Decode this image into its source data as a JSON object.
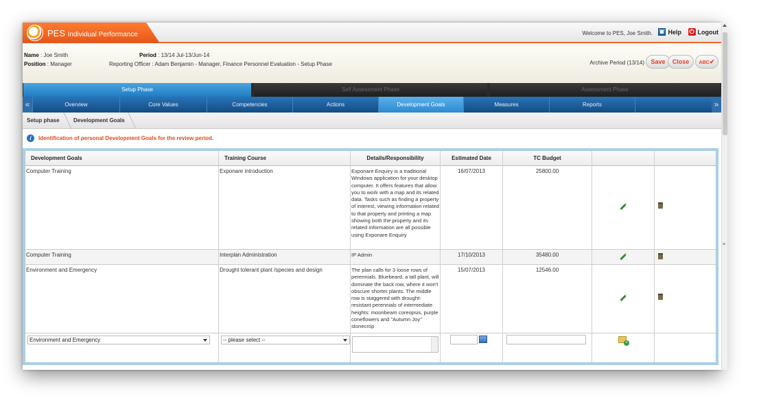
{
  "app": {
    "brand_prefix": "PES",
    "brand_suffix": "Individual Performance",
    "welcome": "Welcome to PES, Joe Smith.",
    "help": "Help",
    "logout": "Logout"
  },
  "info": {
    "name_label": "Name",
    "name_value": ": Joe Smith",
    "position_label": "Position",
    "position_value": ": Manager",
    "period_label": "Period",
    "period_value": ": 13/14 Jul-13/Jun-14",
    "reporting": "Reporting Officer : Adam Benjamin - Manager, Finance Personnel Evaluation - Setup Phase",
    "archive": "Archive Period (13/14)",
    "save": "Save",
    "close": "Close",
    "spell": "ABC"
  },
  "phases": [
    "Setup Phase",
    "Self Assessment Phase",
    "Assessment Phase"
  ],
  "tabs": [
    "Overview",
    "Core Values",
    "Competencies",
    "Actions",
    "Development Goals",
    "Measures",
    "Reports"
  ],
  "breadcrumb": [
    "Setup phase",
    "Development Goals"
  ],
  "notice": "Identification of personal Development Goals for the review period.",
  "table": {
    "headers": [
      "Development Goals",
      "Training Course",
      "Details/Responsibility",
      "Estimated Date",
      "TC Budget"
    ],
    "rows": [
      {
        "goal": "Computer Training",
        "course": "Exponare introduction",
        "details": "Exponare Enquiry is a traditional Windows application for your desktop computer. It offers features that allow you to work with a map and its related data. Tasks such as finding a property of interest, viewing information related to that property and printing a map showing both the property and its related information are all possible using Exponare Enquiry",
        "date": "16/07/2013",
        "budget": "25800.00"
      },
      {
        "goal": "Computer Training",
        "course": "Interplan Administration",
        "details": "IP Admin",
        "date": "17/10/2013",
        "budget": "35480.00"
      },
      {
        "goal": "Environment and Emergency",
        "course": "Drought tolerant plant /species and design",
        "details": "The plan calls for 3 loose rows of perennials. Bluebeard, a tall plant, will dominate the back row, where it won't obscure shorter plants. The middle row is staggered with drought-resistant perennials of intermediate heights: moonbeam coreopsis, purple coneflowers and \"Autumn Joy\" stonecrop",
        "date": "15/07/2013",
        "budget": "12546.00"
      }
    ],
    "new_row": {
      "goal": "Environment and Emergency",
      "course": "-- please select --"
    }
  }
}
